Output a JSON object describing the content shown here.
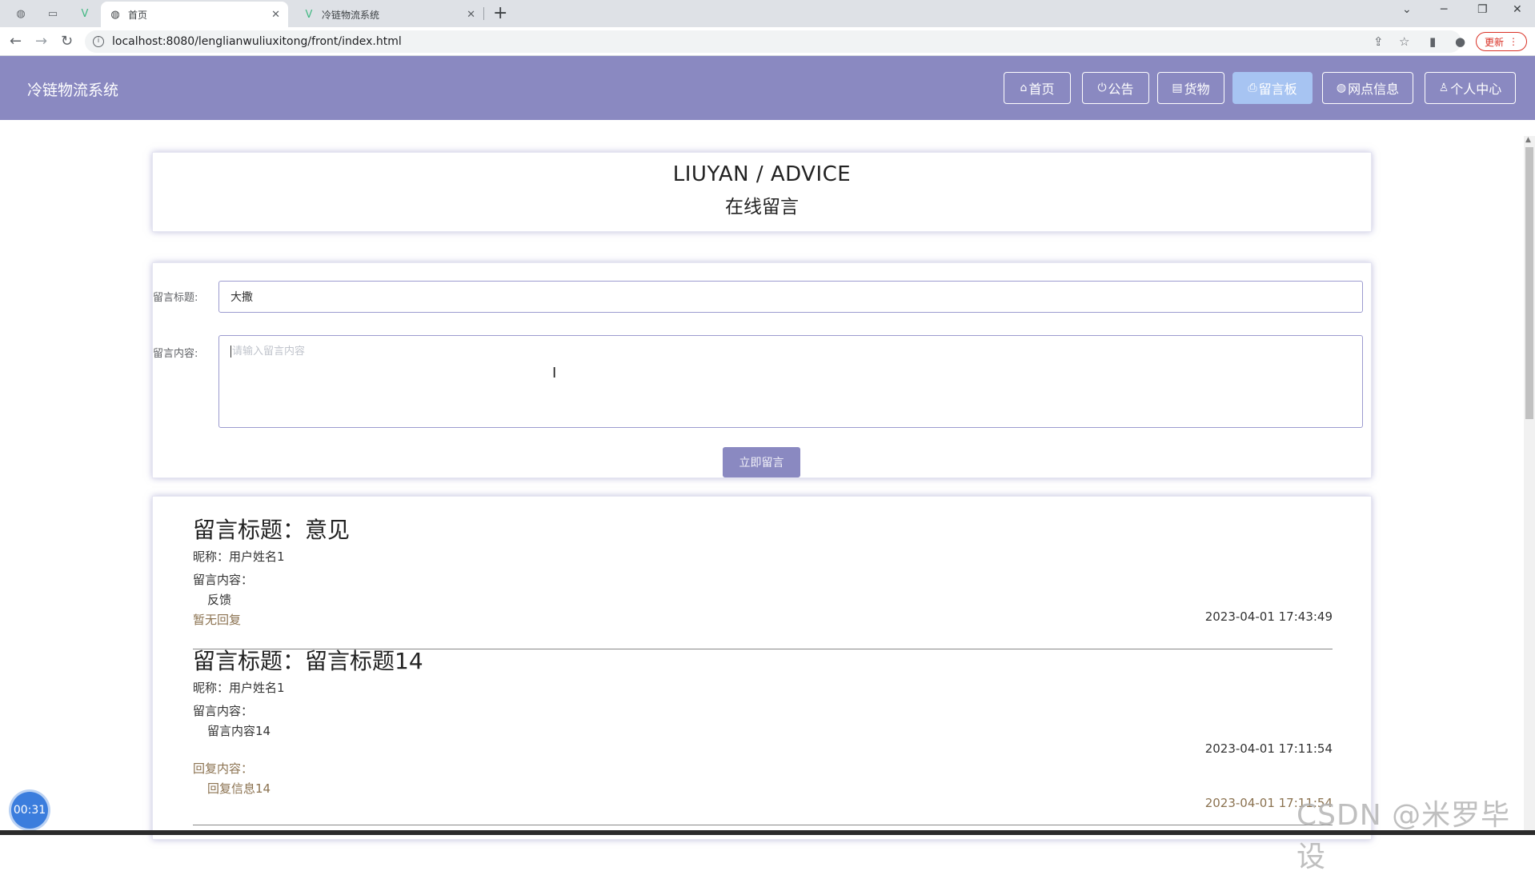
{
  "browser": {
    "tabs": [
      {
        "label": "首页",
        "active": true,
        "icon": "globe-icon"
      },
      {
        "label": "冷链物流系统",
        "active": false,
        "icon": "vue-logo-icon"
      }
    ],
    "url": "localhost:8080/lenglianwuliuxitong/front/index.html",
    "update_label": "更新"
  },
  "header": {
    "site_title": "冷链物流系统",
    "nav": [
      {
        "label": "首页",
        "icon": "home-icon",
        "active": false
      },
      {
        "label": "公告",
        "icon": "power-icon",
        "active": false
      },
      {
        "label": "货物",
        "icon": "box-icon",
        "active": false
      },
      {
        "label": "留言板",
        "icon": "print-icon",
        "active": true
      },
      {
        "label": "网点信息",
        "icon": "globe-icon",
        "active": false
      },
      {
        "label": "个人中心",
        "icon": "user-icon",
        "active": false
      }
    ]
  },
  "banner": {
    "title_en": "LIUYAN / ADVICE",
    "title_cn": "在线留言"
  },
  "form": {
    "title_label": "留言标题:",
    "title_value": "大撒",
    "content_label": "留言内容:",
    "content_placeholder": "请输入留言内容",
    "submit_label": "立即留言"
  },
  "messages": [
    {
      "title": "留言标题：意见",
      "nickname": "昵称：用户姓名1",
      "content_label": "留言内容：",
      "content": "反馈",
      "reply_status": "暂无回复",
      "time": "2023-04-01 17:43:49"
    },
    {
      "title": "留言标题：留言标题14",
      "nickname": "昵称：用户姓名1",
      "content_label": "留言内容：",
      "content": "留言内容14",
      "time": "2023-04-01 17:11:54",
      "reply_label": "回复内容：",
      "reply": "回复信息14",
      "reply_time": "2023-04-01 17:11:54"
    }
  ],
  "overlay": {
    "timer": "00:31",
    "watermark": "CSDN @米罗毕设"
  }
}
